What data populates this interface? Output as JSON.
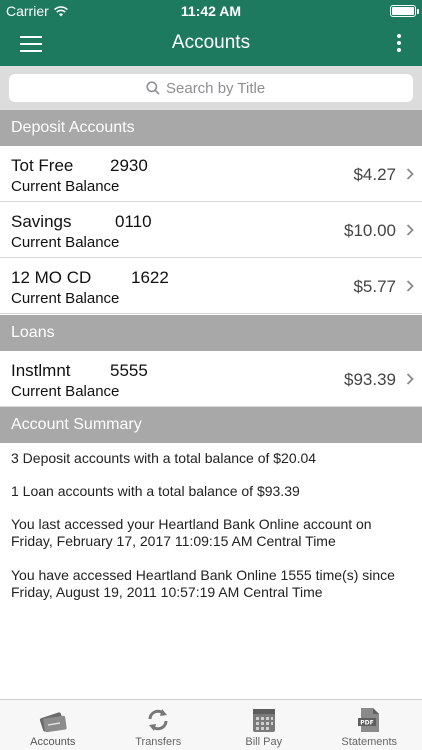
{
  "status_bar": {
    "carrier": "Carrier",
    "time": "11:42 AM"
  },
  "nav": {
    "title": "Accounts"
  },
  "search": {
    "placeholder": "Search by Title"
  },
  "sections": {
    "deposit": "Deposit Accounts",
    "loans": "Loans",
    "summary": "Account Summary"
  },
  "deposit_accounts": [
    {
      "name": "Tot Free",
      "number": "2930",
      "subtitle": "Current Balance",
      "amount": "$4.27"
    },
    {
      "name": "Savings",
      "number": "0110",
      "subtitle": "Current Balance",
      "amount": "$10.00"
    },
    {
      "name": "12 MO CD",
      "number": "1622",
      "subtitle": "Current Balance",
      "amount": "$5.77"
    }
  ],
  "loans": [
    {
      "name": "Instlmnt",
      "number": "5555",
      "subtitle": "Current Balance",
      "amount": "$93.39"
    }
  ],
  "summary": {
    "deposit_line": "3 Deposit accounts with a total balance of $20.04",
    "loan_line": "1 Loan accounts with a total balance of $93.39",
    "last_access": "You last accessed your Heartland Bank Online account on Friday, February 17, 2017 11:09:15 AM Central Time",
    "access_count": "You have accessed Heartland Bank Online 1555 time(s) since Friday, August 19, 2011 10:57:19 AM Central Time"
  },
  "tabs": [
    {
      "label": "Accounts",
      "icon": "accounts-icon"
    },
    {
      "label": "Transfers",
      "icon": "transfers-icon"
    },
    {
      "label": "Bill Pay",
      "icon": "calendar-icon"
    },
    {
      "label": "Statements",
      "icon": "pdf-icon"
    }
  ],
  "colors": {
    "brand": "#1e7a5e",
    "section_header": "#a8a8a8"
  }
}
